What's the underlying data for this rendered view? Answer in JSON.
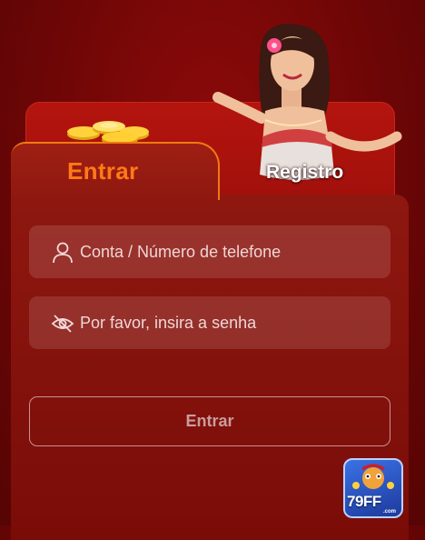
{
  "tabs": {
    "login_label": "Entrar",
    "register_label": "Registro"
  },
  "form": {
    "account_placeholder": "Conta / Número de telefone",
    "password_placeholder": "Por favor, insira a senha",
    "submit_label": "Entrar"
  },
  "logo": {
    "text": "79FF",
    "suffix": ".com"
  },
  "icons": {
    "account": "user-icon",
    "password": "eye-off-icon"
  },
  "colors": {
    "background": "#6e0606",
    "active_tab_text": "#ff7a16",
    "active_tab_border": "#f07a12",
    "register_tab_text": "#ffffff"
  }
}
